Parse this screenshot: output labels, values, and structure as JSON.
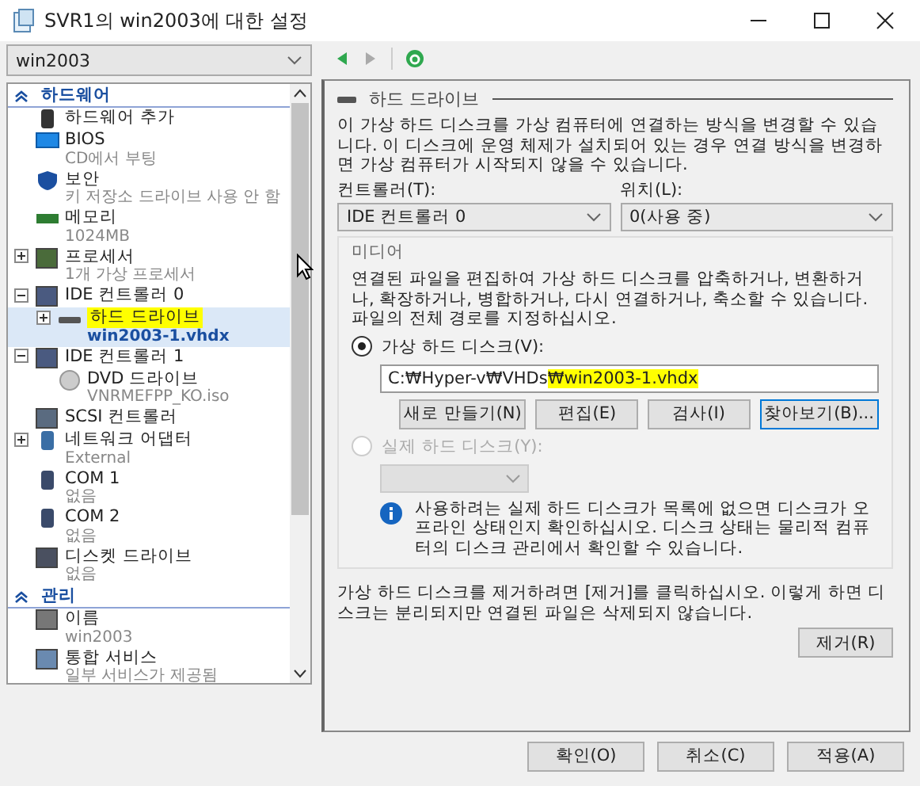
{
  "window": {
    "title": "SVR1의 win2003에 대한 설정"
  },
  "vm_select": {
    "value": "win2003"
  },
  "sidebar": {
    "sections": [
      {
        "title": "하드웨어",
        "expanded": true,
        "items": [
          {
            "kind": "add",
            "label": "하드웨어 추가",
            "selected": false,
            "highlighted": false
          },
          {
            "kind": "bios",
            "label": "BIOS",
            "detail": "CD에서 부팅",
            "selected": false,
            "highlighted": false
          },
          {
            "kind": "security",
            "label": "보안",
            "detail": "키 저장소 드라이브 사용 안 함",
            "selected": false,
            "highlighted": false
          },
          {
            "kind": "memory",
            "label": "메모리",
            "detail": "1024MB",
            "selected": false,
            "highlighted": false
          },
          {
            "kind": "processor",
            "label": "프로세서",
            "detail": "1개 가상 프로세서",
            "expanded": false,
            "selected": false,
            "highlighted": false
          },
          {
            "kind": "controller",
            "label": "IDE 컨트롤러 0",
            "expanded": true,
            "selected": false,
            "highlighted": false,
            "children": [
              {
                "kind": "disk",
                "label": "하드 드라이브",
                "detail": "win2003-1.vhdx",
                "expanded": false,
                "selected": true,
                "highlighted": true
              }
            ]
          },
          {
            "kind": "controller",
            "label": "IDE 컨트롤러 1",
            "expanded": true,
            "selected": false,
            "highlighted": false,
            "children": [
              {
                "kind": "dvd",
                "label": "DVD 드라이브",
                "detail": "VNRMEFPP_KO.iso",
                "selected": false,
                "highlighted": false
              }
            ]
          },
          {
            "kind": "scsi",
            "label": "SCSI 컨트롤러",
            "selected": false,
            "highlighted": false
          },
          {
            "kind": "network",
            "label": "네트워크 어댑터",
            "detail": "External",
            "expanded": false,
            "selected": false,
            "highlighted": false
          },
          {
            "kind": "port",
            "label": "COM 1",
            "detail": "없음",
            "selected": false,
            "highlighted": false
          },
          {
            "kind": "port",
            "label": "COM 2",
            "detail": "없음",
            "selected": false,
            "highlighted": false
          },
          {
            "kind": "floppy",
            "label": "디스켓 드라이브",
            "detail": "없음",
            "selected": false,
            "highlighted": false
          }
        ]
      },
      {
        "title": "관리",
        "expanded": true,
        "items": [
          {
            "kind": "name",
            "label": "이름",
            "detail": "win2003",
            "selected": false,
            "highlighted": false
          },
          {
            "kind": "services",
            "label": "통합 서비스",
            "detail": "일부 서비스가 제공됨",
            "selected": false,
            "highlighted": false
          }
        ]
      }
    ]
  },
  "panel": {
    "title": "하드 드라이브",
    "description": "이 가상 하드 디스크를 가상 컴퓨터에 연결하는 방식을 변경할 수 있습니다. 이 디스크에 운영 체제가 설치되어 있는 경우 연결 방식을 변경하면 가상 컴퓨터가 시작되지 않을 수 있습니다.",
    "controller": {
      "label": "컨트롤러(T):",
      "value": "IDE 컨트롤러 0"
    },
    "location": {
      "label": "위치(L):",
      "value": "0(사용 중)"
    },
    "media": {
      "title": "미디어",
      "description": "연결된 파일을 편집하여 가상 하드 디스크를 압축하거나, 변환하거나, 확장하거나, 병합하거나, 다시 연결하거나, 축소할 수 있습니다. 파일의 전체 경로를 지정하십시오.",
      "virtual": {
        "label": "가상 하드 디스크(V):",
        "selected": true,
        "disabled": false
      },
      "path": {
        "plain": "C:₩Hyper-v₩VHDs",
        "marked": "₩win2003-1.vhdx"
      },
      "buttons": [
        {
          "label": "새로 만들기(N)",
          "focused": false
        },
        {
          "label": "편집(E)",
          "focused": false
        },
        {
          "label": "검사(I)",
          "focused": false
        },
        {
          "label": "찾아보기(B)...",
          "focused": true
        }
      ],
      "physical": {
        "label": "실제 하드 디스크(Y):",
        "selected": false,
        "disabled": true
      },
      "info": "사용하려는 실제 하드 디스크가 목록에 없으면 디스크가 오프라인 상태인지 확인하십시오. 디스크 상태는 물리적 컴퓨터의 디스크 관리에서 확인할 수 있습니다."
    },
    "remove_note": "가상 하드 디스크를 제거하려면 [제거]를 클릭하십시오. 이렇게 하면 디스크는 분리되지만 연결된 파일은 삭제되지 않습니다.",
    "remove_button": "제거(R)"
  },
  "buttons": [
    "확인(O)",
    "취소(C)",
    "적용(A)"
  ]
}
